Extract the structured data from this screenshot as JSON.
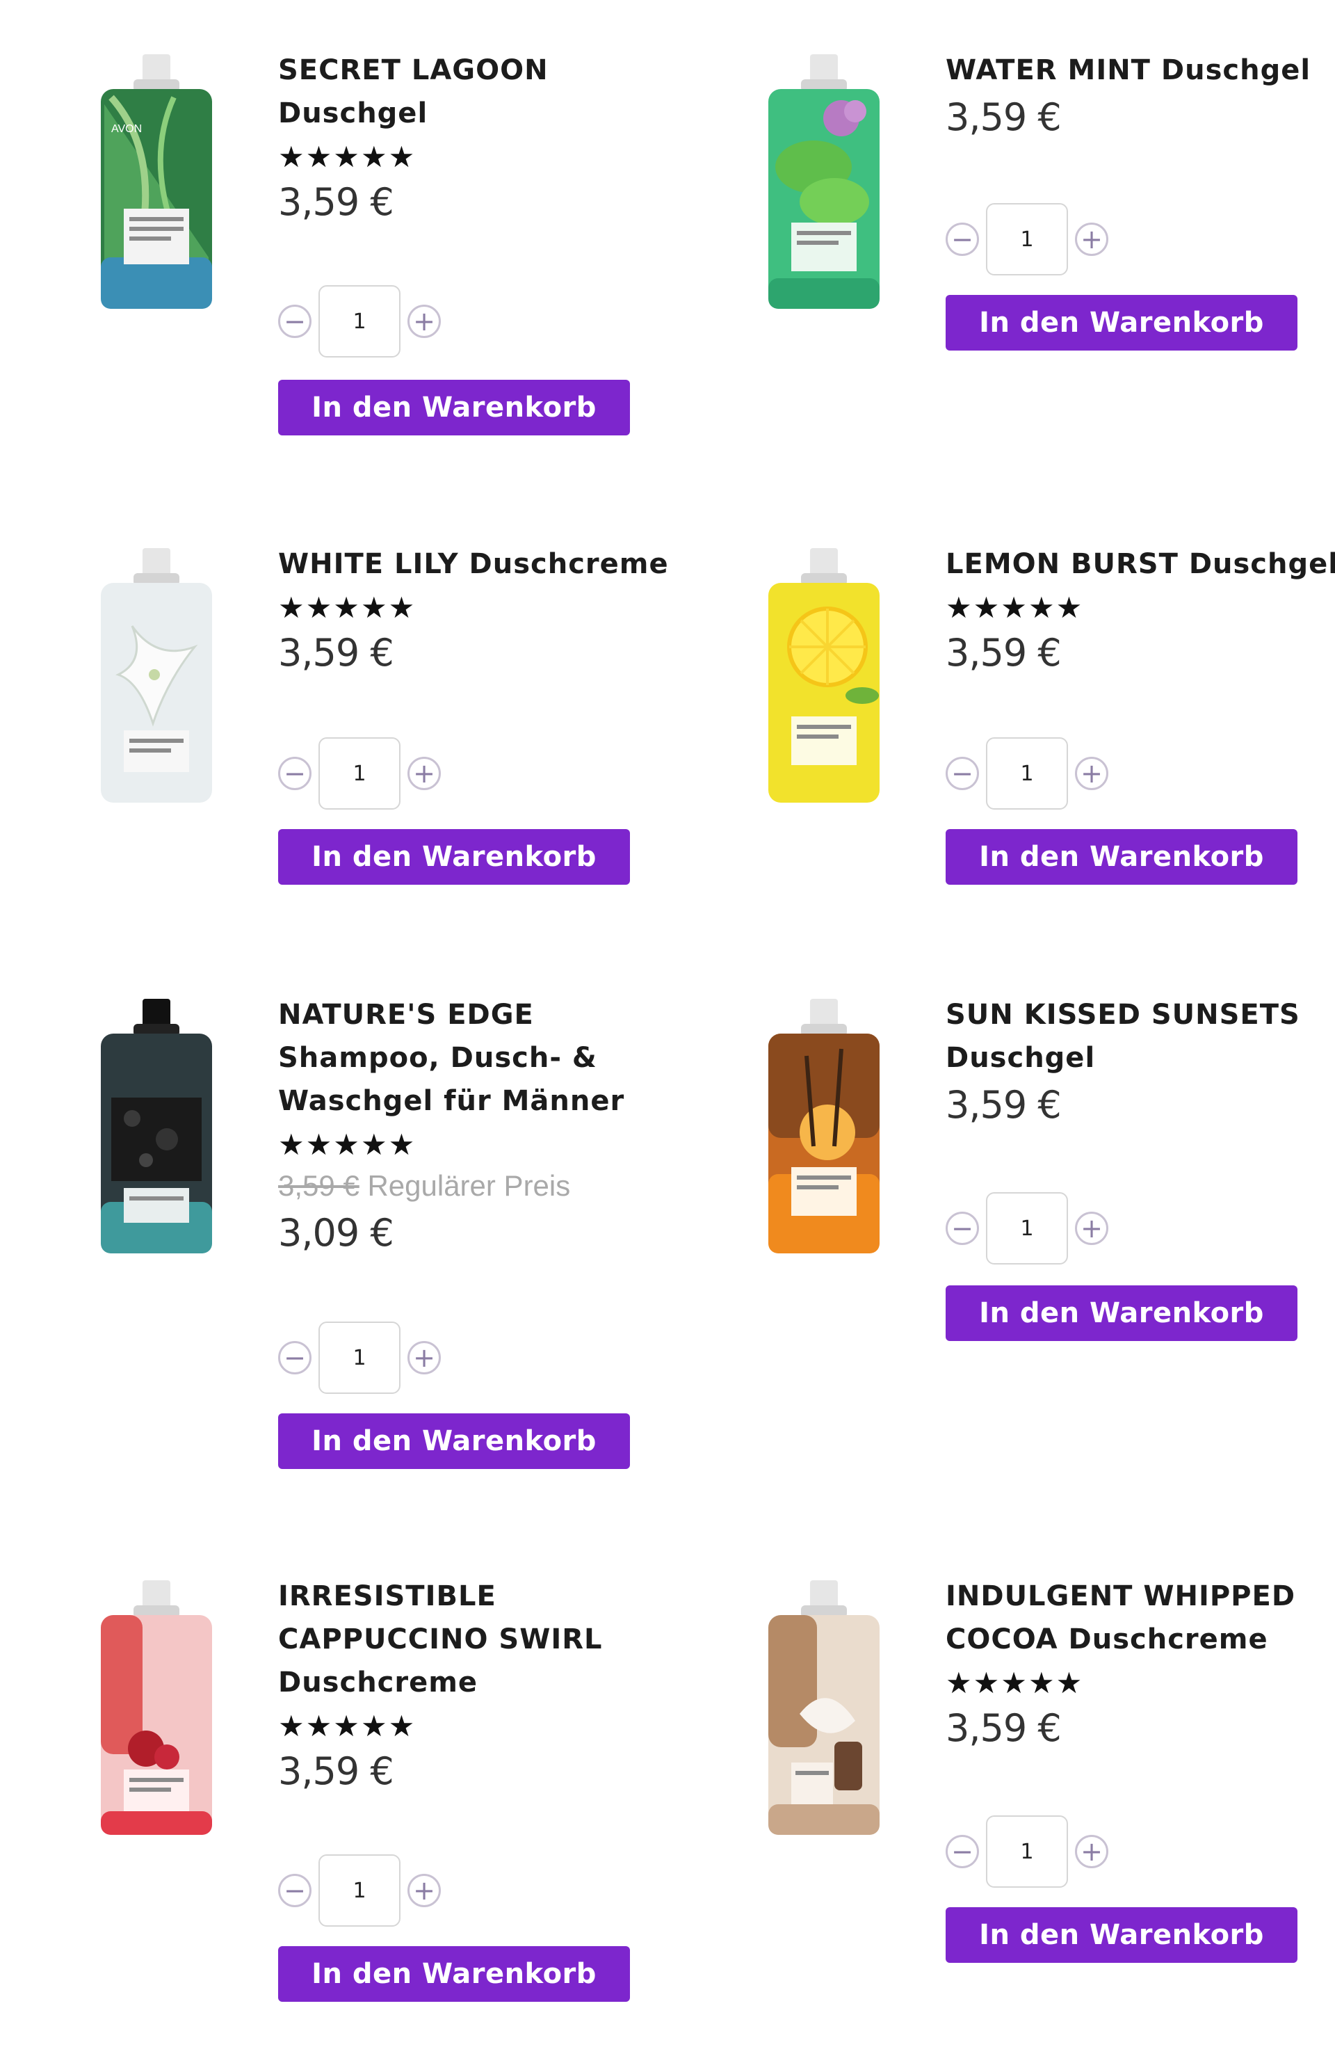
{
  "currency_note": "",
  "colors": {
    "button": "#7d26cd",
    "qty_border": "#c9c2d3"
  },
  "cart_label": "In den Warenkorb",
  "products": [
    {
      "name_lines": [
        "SECRET LAGOON",
        "Duschgel"
      ],
      "stars": "★★★★★",
      "rating": 5,
      "old_price": "",
      "old_price_note": "",
      "price": "3,59 €",
      "qty": "1",
      "button": "In den Warenkorb",
      "image": "green-leaf-bottle"
    },
    {
      "name_lines": [
        "WATER MINT Duschgel"
      ],
      "stars": "",
      "rating": null,
      "old_price": "",
      "old_price_note": "",
      "price": "3,59 €",
      "qty": "1",
      "button": "In den Warenkorb",
      "image": "mint-bottle"
    },
    {
      "name_lines": [
        "WHITE LILY Duschcreme"
      ],
      "stars": "★★★★★",
      "rating": 4.5,
      "old_price": "",
      "old_price_note": "",
      "price": "3,59 €",
      "qty": "1",
      "button": "In den Warenkorb",
      "image": "white-lily-bottle"
    },
    {
      "name_lines": [
        "LEMON BURST Duschgel"
      ],
      "stars": "★★★★★",
      "rating": 5,
      "old_price": "",
      "old_price_note": "",
      "price": "3,59 €",
      "qty": "1",
      "button": "In den Warenkorb",
      "image": "lemon-bottle"
    },
    {
      "name_lines": [
        "NATURE'S EDGE",
        "Shampoo, Dusch- &",
        "Waschgel für Männer"
      ],
      "stars": "★★★★★",
      "rating": 5,
      "old_price": "3,59 €",
      "old_price_note": "Regulärer Preis",
      "price": "3,09 €",
      "qty": "1",
      "button": "In den Warenkorb",
      "image": "charcoal-bottle"
    },
    {
      "name_lines": [
        "SUN KISSED SUNSETS",
        "Duschgel"
      ],
      "stars": "",
      "rating": null,
      "old_price": "",
      "old_price_note": "",
      "price": "3,59 €",
      "qty": "1",
      "button": "In den Warenkorb",
      "image": "sunset-bottle"
    },
    {
      "name_lines": [
        "IRRESISTIBLE",
        "CAPPUCCINO SWIRL",
        "Duschcreme"
      ],
      "stars": "★★★★★",
      "rating": 5,
      "old_price": "",
      "old_price_note": "",
      "price": "3,59 €",
      "qty": "1",
      "button": "In den Warenkorb",
      "image": "cherry-bottle"
    },
    {
      "name_lines": [
        "INDULGENT WHIPPED",
        "COCOA Duschcreme"
      ],
      "stars": "★★★★★",
      "rating": 5,
      "old_price": "",
      "old_price_note": "",
      "price": "3,59 €",
      "qty": "1",
      "button": "In den Warenkorb",
      "image": "cocoa-bottle"
    }
  ]
}
